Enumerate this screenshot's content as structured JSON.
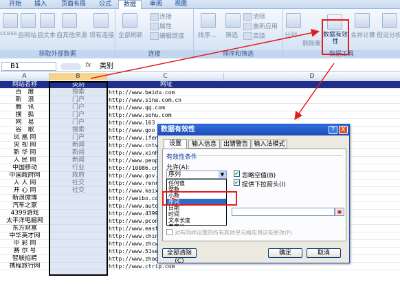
{
  "tabs": [
    "开始",
    "插入",
    "页面布局",
    "公式",
    "数据",
    "审阅",
    "视图"
  ],
  "active_tab": 4,
  "ribbon": {
    "groups": [
      {
        "label": "获取外部数据",
        "buttons": [
          "ccess",
          "自网站",
          "自文本",
          "自其他来源",
          "现有连接"
        ]
      },
      {
        "label": "连接",
        "buttons": [
          "全部刷新",
          "连接",
          "属性",
          "编辑链接"
        ]
      },
      {
        "label": "排序和筛选",
        "buttons": [
          "排序...",
          "筛选",
          "清除",
          "重新应用",
          "高级"
        ]
      },
      {
        "label": "数据工具",
        "buttons": [
          "分列",
          "删除重复项",
          "数据有效性",
          "合并计算",
          "假设分析"
        ]
      }
    ],
    "highlight_button": "数据有效性"
  },
  "formula_bar": {
    "name_box": "B1",
    "fx": "fx",
    "content": "类别"
  },
  "columns": [
    "A",
    "B",
    "C",
    "D"
  ],
  "table": {
    "headers": [
      "网站名称",
      "类别",
      "网址"
    ],
    "rows": [
      [
        "百　度",
        "搜索",
        "http://www.baidu.com"
      ],
      [
        "新　浪",
        "门户",
        "http://www.sina.com.cn"
      ],
      [
        "腾　讯",
        "门户",
        "http://www.qq.com"
      ],
      [
        "搜　狐",
        "门户",
        "http://www.sohu.com"
      ],
      [
        "网　易",
        "门户",
        "http://www.163"
      ],
      [
        "谷　歌",
        "搜索",
        "http://www.goo"
      ],
      [
        "凤 凰 网",
        "门户",
        "http://www.ifen"
      ],
      [
        "央 视 网",
        "新闻",
        "http://www.cntv"
      ],
      [
        "新 华 网",
        "新闻",
        "http://www.xinh"
      ],
      [
        "人 民 网",
        "新闻",
        "http://www.peop"
      ],
      [
        "中国移动",
        "行业",
        "http://10086.cn"
      ],
      [
        "中国政府网",
        "政府",
        "http://www.gov."
      ],
      [
        "人 人 网",
        "社交",
        "http://www.renr"
      ],
      [
        "开 心 网",
        "社交",
        "http://www.kaix"
      ],
      [
        "新浪微博",
        "",
        "http://weibo.com"
      ],
      [
        "汽车之家",
        "",
        "http://www.auto"
      ],
      [
        "4399游戏",
        "",
        "http://www.4399"
      ],
      [
        "太平洋电脑网",
        "",
        "http://www.pcon"
      ],
      [
        "东方财富",
        "",
        "http://www.east"
      ],
      [
        "中华英才网",
        "",
        "http://www.chin"
      ],
      [
        "中 彩 网",
        "",
        "http://www.zhcw"
      ],
      [
        "赛 尔 号",
        "",
        "http://www.51se"
      ],
      [
        "智联招聘",
        "",
        "http://www.zhao"
      ],
      [
        "携程旅行网",
        "",
        "http://www.ctrip.com"
      ]
    ]
  },
  "dialog": {
    "title": "数据有效性",
    "help": "?",
    "close": "X",
    "tabs": [
      "设置",
      "输入信息",
      "出错警告",
      "输入法模式"
    ],
    "section": "有效性条件",
    "allow_label": "允许(A):",
    "allow_value": "序列",
    "options": [
      "任何值",
      "整数",
      "小数",
      "序列",
      "日期",
      "时间",
      "文本长度",
      "自定义"
    ],
    "selected_option": 3,
    "ignore_blank": "忽略空值(B)",
    "dropdown_arrow": "提供下拉箭头(I)",
    "apply_all": "对有同样设置的所有其他单元格应用这些更改(P)",
    "clear_all": "全部清除(C)",
    "ok": "确定",
    "cancel": "取消"
  },
  "colors": {
    "accent_red": "#e31b1b",
    "header_blue": "#1f2f8a"
  }
}
